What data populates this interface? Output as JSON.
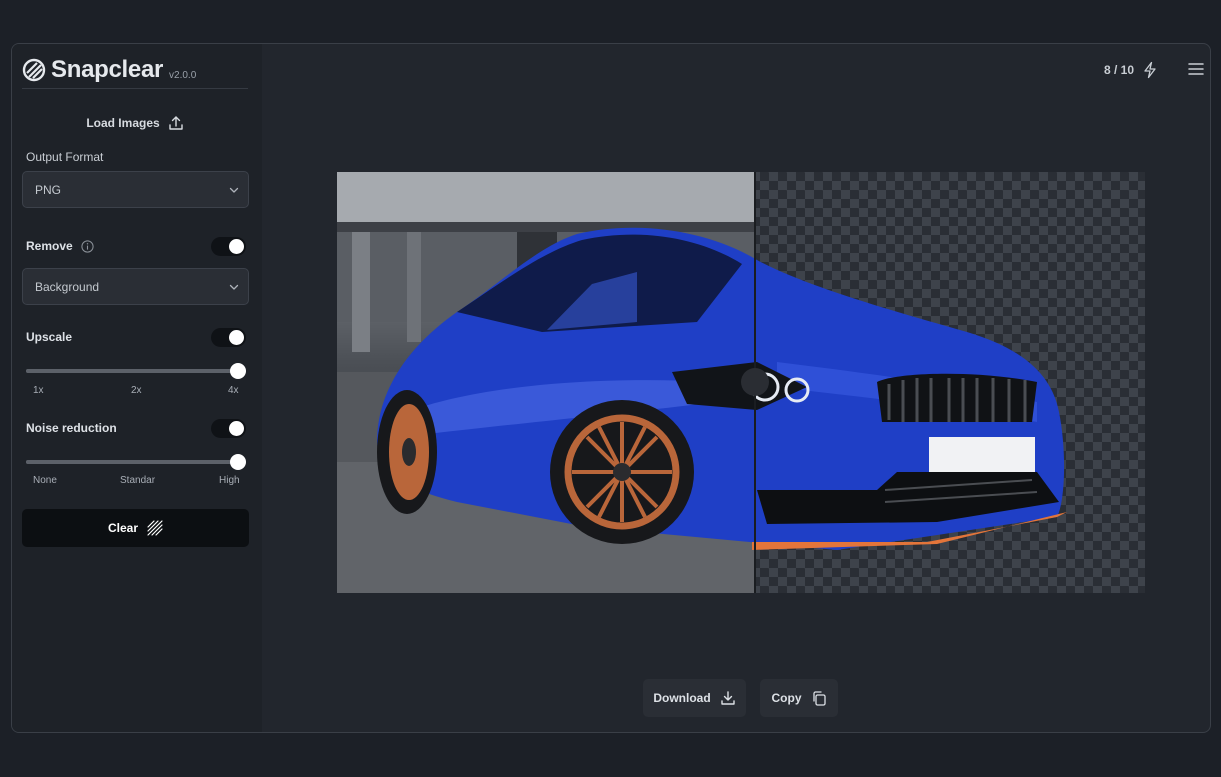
{
  "app": {
    "name": "Snapclear",
    "version": "v2.0.0"
  },
  "sidebar": {
    "load_label": "Load Images",
    "output_format": {
      "label": "Output Format",
      "value": "PNG"
    },
    "remove": {
      "label": "Remove",
      "enabled": true,
      "value": "Background"
    },
    "upscale": {
      "label": "Upscale",
      "enabled": true,
      "ticks": [
        "1x",
        "2x",
        "4x"
      ],
      "value": "4x",
      "level_fraction": 1.0
    },
    "noise_reduction": {
      "label": "Noise reduction",
      "enabled": true,
      "ticks": [
        "None",
        "Standar",
        "High"
      ],
      "value": "High",
      "level_fraction": 1.0
    },
    "clear_label": "Clear"
  },
  "header": {
    "credits": "8 / 10"
  },
  "preview": {
    "compare_position_fraction": 0.517
  },
  "actions": {
    "download_label": "Download",
    "copy_label": "Copy"
  },
  "icons": {
    "logo": "snapclear-logo-icon",
    "upload": "upload-icon",
    "chevron": "chevron-down-icon",
    "info": "info-icon",
    "clear": "diagonal-lines-icon",
    "credits": "lightning-icon",
    "menu": "hamburger-menu-icon",
    "download": "download-icon",
    "copy": "copy-icon"
  },
  "colors": {
    "background": "#1c2027",
    "panel": "#22262d",
    "sidebar": "#1e2228",
    "primary_button": "#0c0f12",
    "car_blue": "#1f3fc6",
    "wheel_bronze": "#b9663a"
  }
}
